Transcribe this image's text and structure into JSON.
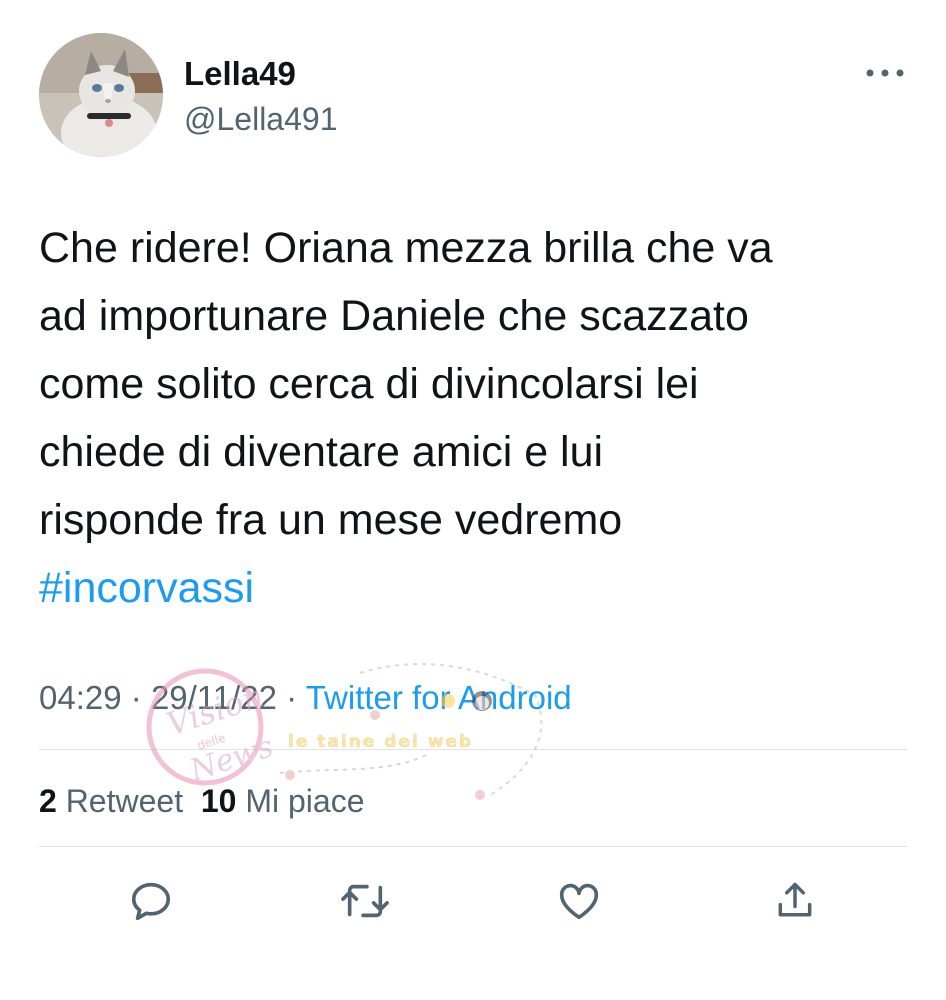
{
  "author": {
    "display_name": "Lella49",
    "handle": "@Lella491",
    "avatar_icon": "cat-avatar"
  },
  "tweet": {
    "lines": [
      "Che ridere! Oriana mezza brilla che va",
      "ad importunare Daniele che scazzato",
      "come solito cerca di divincolarsi lei",
      "chiede di diventare amici e lui",
      "risponde fra un mese vedremo"
    ],
    "hashtag": "#incorvassi"
  },
  "meta": {
    "time": "04:29",
    "separator": "·",
    "date": "29/11/22",
    "source": "Twitter for Android"
  },
  "stats": {
    "retweets_count": "2",
    "retweets_label": "Retweet",
    "likes_count": "10",
    "likes_label": "Mi piace"
  },
  "actions": [
    {
      "name": "reply-icon"
    },
    {
      "name": "retweet-icon"
    },
    {
      "name": "like-icon"
    },
    {
      "name": "share-icon"
    }
  ],
  "colors": {
    "text": "#0f1419",
    "secondary": "#536471",
    "link": "#1d9bf0",
    "divider": "#dfe3e6"
  },
  "watermark": {
    "left_text": "Vision delle News",
    "right_text": "le taine dei web"
  }
}
